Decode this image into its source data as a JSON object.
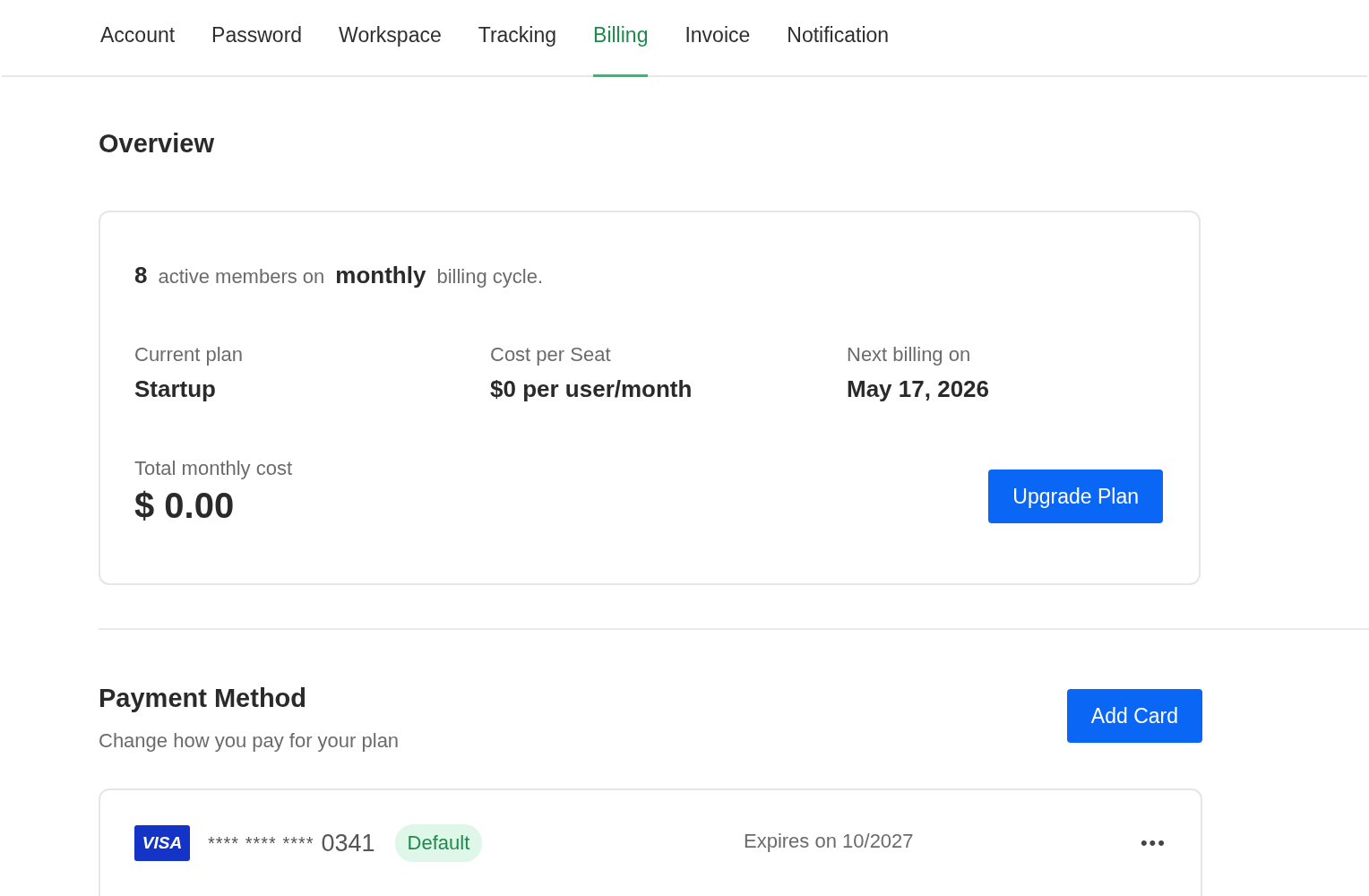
{
  "tabs": [
    {
      "label": "Account",
      "selected": false
    },
    {
      "label": "Password",
      "selected": false
    },
    {
      "label": "Workspace",
      "selected": false
    },
    {
      "label": "Tracking",
      "selected": false
    },
    {
      "label": "Billing",
      "selected": true
    },
    {
      "label": "Invoice",
      "selected": false
    },
    {
      "label": "Notification",
      "selected": false
    }
  ],
  "overview": {
    "title": "Overview",
    "summary": {
      "count": "8",
      "before": "active members on",
      "cycle": "monthly",
      "after": "billing cycle."
    },
    "stats": [
      {
        "label": "Current plan",
        "value": "Startup"
      },
      {
        "label": "Cost per Seat",
        "value": "$0 per user/month"
      },
      {
        "label": "Next billing on",
        "value": "May 17, 2026"
      }
    ],
    "total": {
      "label": "Total monthly cost",
      "value": "$ 0.00"
    },
    "button": "Upgrade Plan"
  },
  "payment": {
    "title": "Payment Method",
    "subtitle": "Change how you pay for your plan",
    "button": "Add Card",
    "cards": [
      {
        "brand": "VISA",
        "masked": "**** **** ****",
        "last4": "0341",
        "badge": "Default",
        "expiry": "Expires on 10/2027",
        "menu": "•••"
      }
    ]
  }
}
